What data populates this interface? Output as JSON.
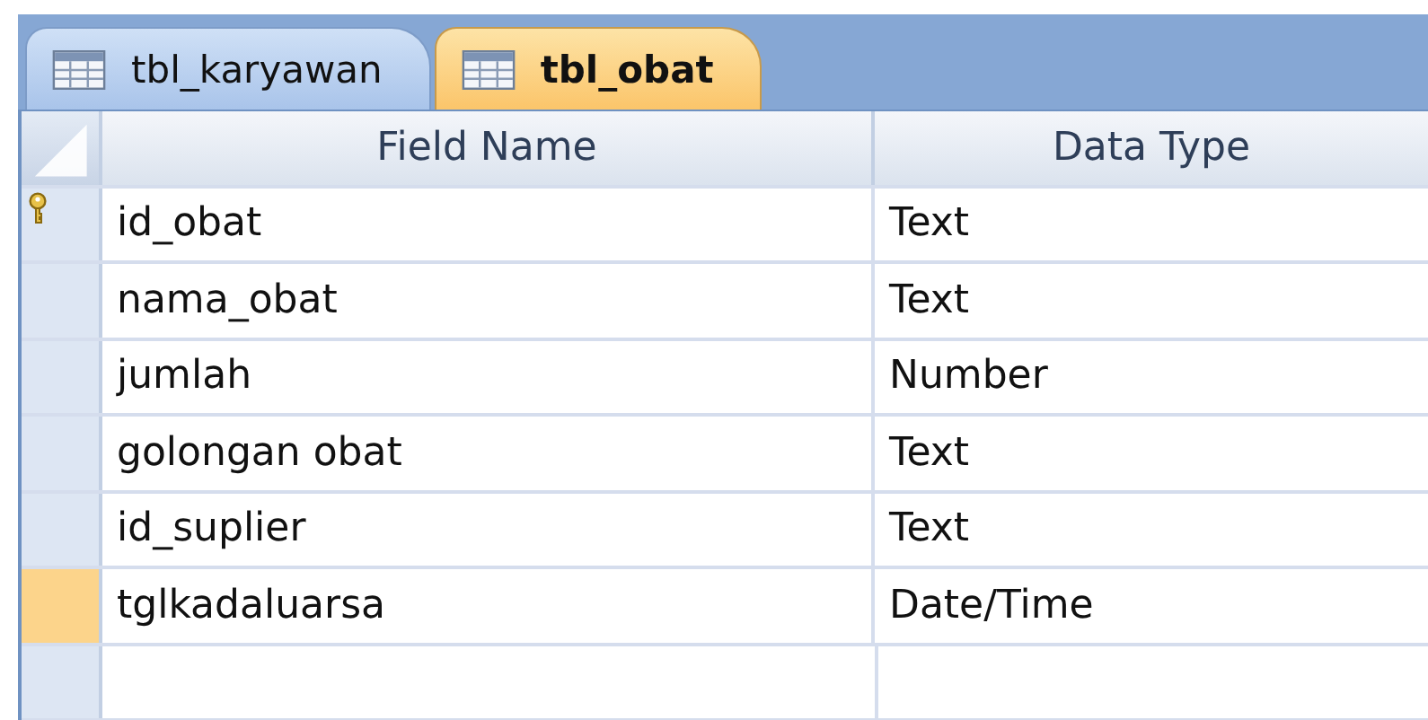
{
  "tabs": [
    {
      "label": "tbl_karyawan",
      "selected": false
    },
    {
      "label": "tbl_obat",
      "selected": true
    }
  ],
  "table": {
    "columns": [
      "Field Name",
      "Data Type"
    ],
    "rows": [
      {
        "field_name": "id_obat",
        "data_type": "Text",
        "primary_key": true,
        "selected": false
      },
      {
        "field_name": "nama_obat",
        "data_type": "Text",
        "primary_key": false,
        "selected": false
      },
      {
        "field_name": "jumlah",
        "data_type": "Number",
        "primary_key": false,
        "selected": false
      },
      {
        "field_name": "golongan obat",
        "data_type": "Text",
        "primary_key": false,
        "selected": false
      },
      {
        "field_name": "id_suplier",
        "data_type": "Text",
        "primary_key": false,
        "selected": false
      },
      {
        "field_name": "tglkadaluarsa",
        "data_type": "Date/Time",
        "primary_key": false,
        "selected": true
      }
    ]
  }
}
